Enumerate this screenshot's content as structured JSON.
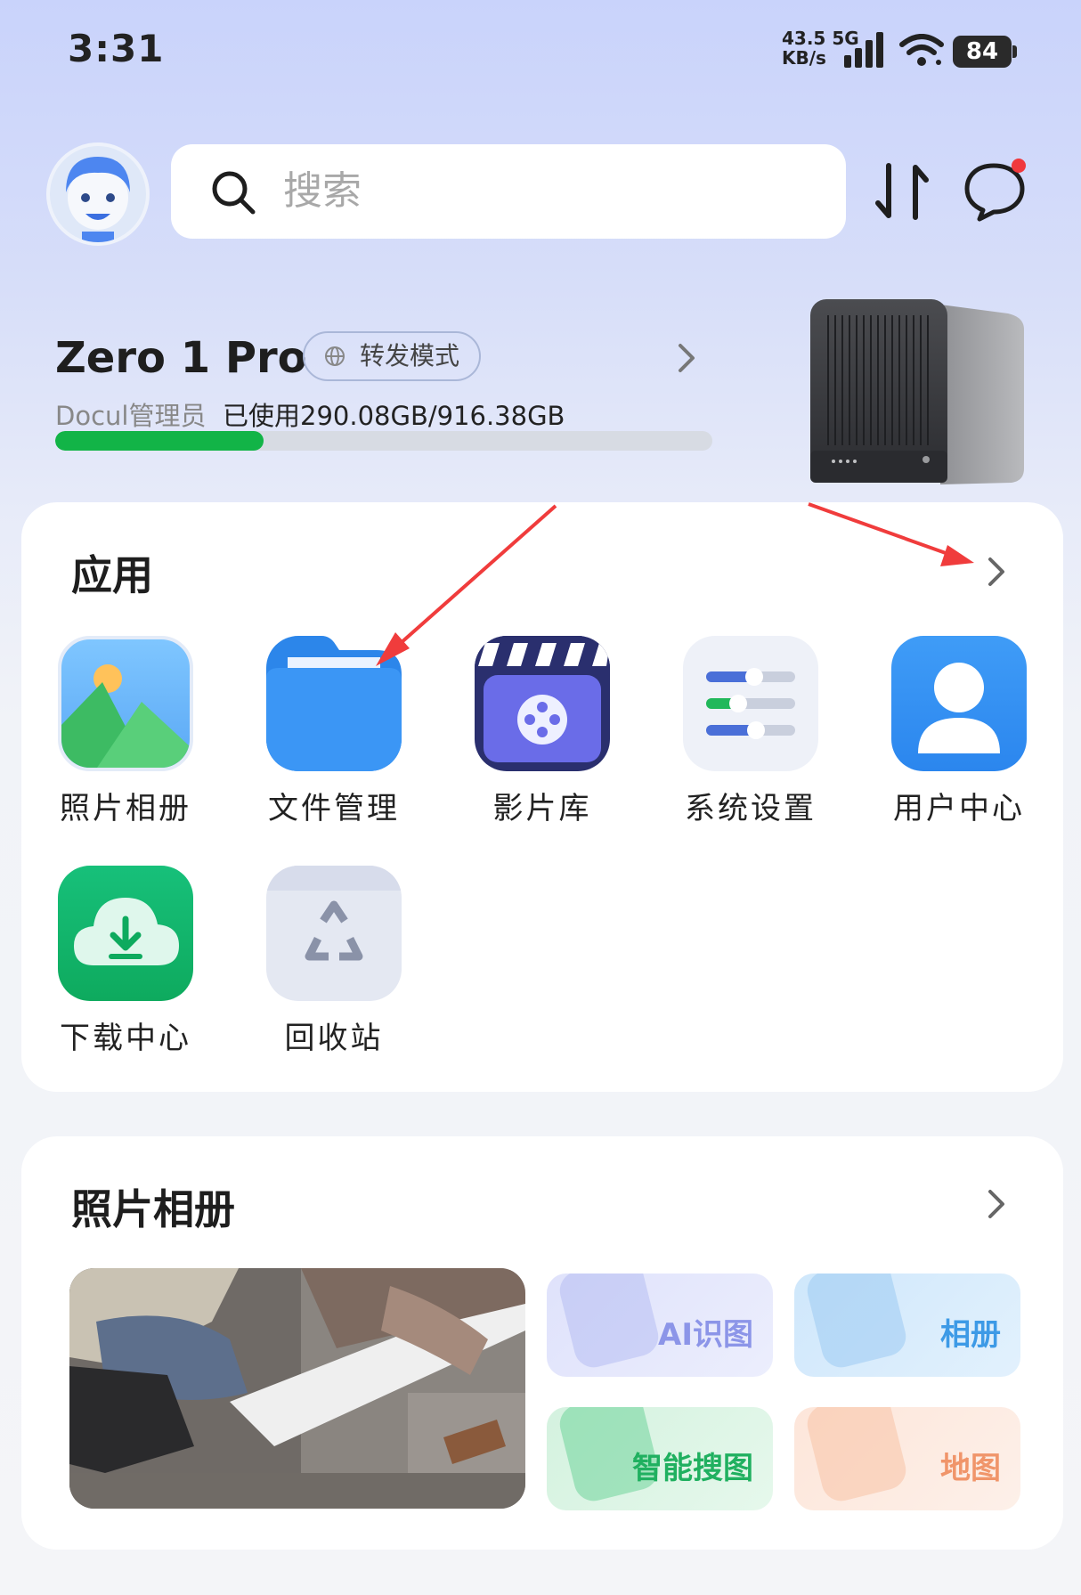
{
  "status_bar": {
    "time": "3:31",
    "net_speed_value": "43.5",
    "net_speed_unit": "KB/s",
    "network_type": "5G",
    "battery": "84"
  },
  "search": {
    "placeholder": "搜索"
  },
  "device": {
    "name": "Zero 1 Pro",
    "mode_badge": "转发模式",
    "user_role": "Docul管理员",
    "usage_text": "已使用290.08GB/916.38GB",
    "storage_used_gb": 290.08,
    "storage_total_gb": 916.38,
    "storage_fraction": 0.317
  },
  "apps_section": {
    "title": "应用",
    "items": [
      {
        "label": "照片相册",
        "icon": "photo-album-icon"
      },
      {
        "label": "文件管理",
        "icon": "folder-icon"
      },
      {
        "label": "影片库",
        "icon": "film-clapper-icon"
      },
      {
        "label": "系统设置",
        "icon": "settings-sliders-icon"
      },
      {
        "label": "用户中心",
        "icon": "user-icon"
      },
      {
        "label": "下载中心",
        "icon": "cloud-download-icon"
      },
      {
        "label": "回收站",
        "icon": "recycle-icon"
      }
    ]
  },
  "photos_section": {
    "title": "照片相册",
    "tiles": [
      {
        "label": "AI识图",
        "color": "#8c95e8"
      },
      {
        "label": "相册",
        "color": "#3d9ae6"
      },
      {
        "label": "智能搜图",
        "color": "#20b060"
      },
      {
        "label": "地图",
        "color": "#f0956a"
      }
    ]
  },
  "colors": {
    "accent_green": "#12b447",
    "notification_dot": "#f0383c"
  }
}
